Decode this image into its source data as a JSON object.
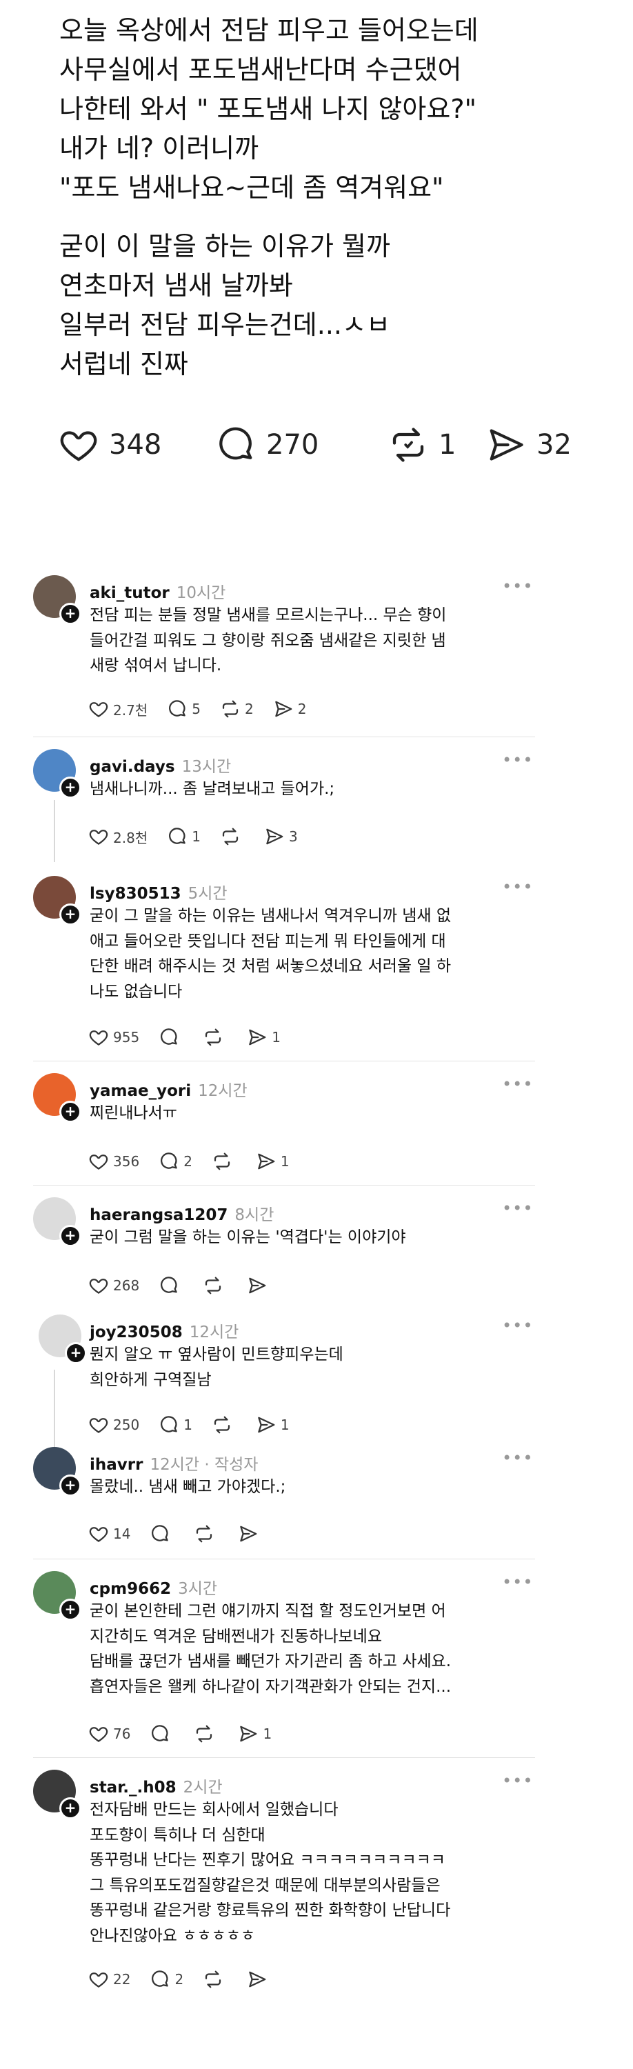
{
  "post": {
    "lines1": [
      "오늘 옥상에서 전담 피우고 들어오는데",
      "사무실에서 포도냄새난다며 수근댔어",
      "나한테 와서 \" 포도냄새 나지 않아요?\"",
      "내가 네? 이러니까",
      "\"포도 냄새나요~근데 좀 역겨워요\""
    ],
    "lines2": [
      "굳이 이 말을 하는 이유가 뭘까",
      "연초마저 냄새 날까봐",
      "일부러 전담 피우는건데...ㅅㅂ",
      "서럽네 진짜"
    ],
    "likes": "348",
    "replies": "270",
    "reposts": "1",
    "shares": "32"
  },
  "comments": [
    {
      "user": "aki_tutor",
      "time": "10시간",
      "text": "전담 피는 분들 정말 냄새를 모르시는구나... 무슨 향이\n들어간걸 피워도 그 향이랑 쥐오줌 냄새같은 지릿한 냄\n새랑 섞여서 납니다.",
      "likes": "2.7천",
      "replies": "5",
      "reposts": "2",
      "shares": "2",
      "avatar": "#6b5a4e"
    },
    {
      "user": "gavi.days",
      "time": "13시간",
      "text": "냄새나니까... 좀 날려보내고 들어가.;",
      "likes": "2.8천",
      "replies": "1",
      "reposts": "",
      "shares": "3",
      "avatar": "#4f86c6"
    },
    {
      "user": "lsy830513",
      "time": "5시간",
      "text": "굳이 그 말을 하는 이유는 냄새나서 역겨우니까 냄새 없\n애고 들어오란 뜻입니다 전담 피는게 뭐 타인들에게 대\n단한 배려 해주시는 것 처럼 써놓으셨네요 서러울 일 하\n나도 없습니다",
      "likes": "955",
      "replies": "",
      "reposts": "",
      "shares": "1",
      "avatar": "#7a4a3a"
    },
    {
      "user": "yamae_yori",
      "time": "12시간",
      "text": "찌린내나서ㅠ",
      "likes": "356",
      "replies": "2",
      "reposts": "",
      "shares": "1",
      "avatar": "#e8632b"
    },
    {
      "user": "haerangsa1207",
      "time": "8시간",
      "text": "굳이 그럼 말을 하는 이유는 '역겹다'는 이야기야",
      "likes": "268",
      "replies": "",
      "reposts": "",
      "shares": "",
      "avatar": "#dcdcdc"
    },
    {
      "user": "joy230508",
      "time": "12시간",
      "text": "뭔지 알오 ㅠ 옆사람이 민트향피우는데\n희안하게 구역질남",
      "likes": "250",
      "replies": "1",
      "reposts": "",
      "shares": "1",
      "avatar": "#dcdcdc"
    },
    {
      "user": "ihavrr",
      "time": "12시간 · 작성자",
      "text": "몰랐네.. 냄새 빼고 가야겠다.;",
      "likes": "14",
      "replies": "",
      "reposts": "",
      "shares": "",
      "avatar": "#3b4a5c"
    },
    {
      "user": "cpm9662",
      "time": "3시간",
      "text": "굳이 본인한테 그런 얘기까지 직접 할 정도인거보면 어\n지간히도 역겨운 담배쩐내가 진동하나보네요\n담배를 끊던가 냄새를 빼던가 자기관리 좀 하고 사세요.\n흡연자들은 왤케 하나같이 자기객관화가 안되는 건지...",
      "likes": "76",
      "replies": "",
      "reposts": "",
      "shares": "1",
      "avatar": "#5a8a5a"
    },
    {
      "user": "star._.h08",
      "time": "2시간",
      "text": "전자담배 만드는 회사에서 일했습니다\n포도향이 특히나 더 심한대\n똥꾸렁내 난다는 찐후기 많어요 ㅋㅋㅋㅋㅋㅋㅋㅋㅋㅋ\n그 특유의포도껍질향같은것 때문에 대부분의사람들은\n똥꾸렁내 같은거랑 향료특유의 찐한 화학향이 난답니다\n안나진않아요 ㅎㅎㅎㅎㅎ",
      "likes": "22",
      "replies": "2",
      "reposts": "",
      "shares": "",
      "avatar": "#3a3a3a"
    }
  ]
}
